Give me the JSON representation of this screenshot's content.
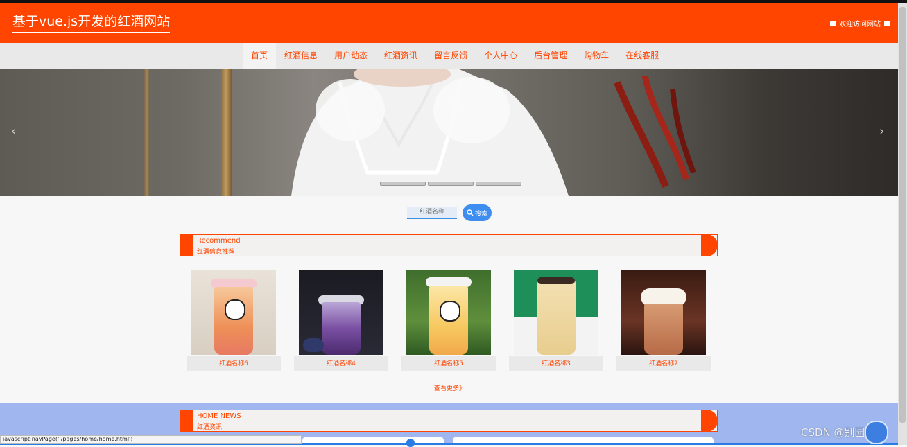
{
  "site": {
    "title": "基于vue.js开发的红酒网站",
    "welcome": "欢迎访问网站"
  },
  "nav": {
    "items": [
      "首页",
      "红酒信息",
      "用户动态",
      "红酒资讯",
      "留言反馈",
      "个人中心",
      "后台管理",
      "购物车",
      "在线客服"
    ],
    "active": 0
  },
  "banner": {
    "prev_icon": "‹",
    "next_icon": "›",
    "slide_count": 3
  },
  "search": {
    "placeholder": "红酒名称",
    "button_label": "搜索"
  },
  "recommend": {
    "title_en": "Recommend",
    "title_cn": "红酒信息推荐"
  },
  "products": [
    {
      "name": "红酒名称6"
    },
    {
      "name": "红酒名称4"
    },
    {
      "name": "红酒名称5"
    },
    {
      "name": "红酒名称3"
    },
    {
      "name": "红酒名称2"
    }
  ],
  "more_label": "查看更多》",
  "news": {
    "title_en": "HOME NEWS",
    "title_cn": "红酒资讯"
  },
  "status_bar": {
    "url": "javascript:navPage('./pages/home/home.html')"
  },
  "watermark": "CSDN @别园科技",
  "colors": {
    "primary": "#ff4500",
    "nav_bg": "#e9e9e9",
    "search_button": "#3d8ef0",
    "news_bg": "#9fb7ee"
  }
}
